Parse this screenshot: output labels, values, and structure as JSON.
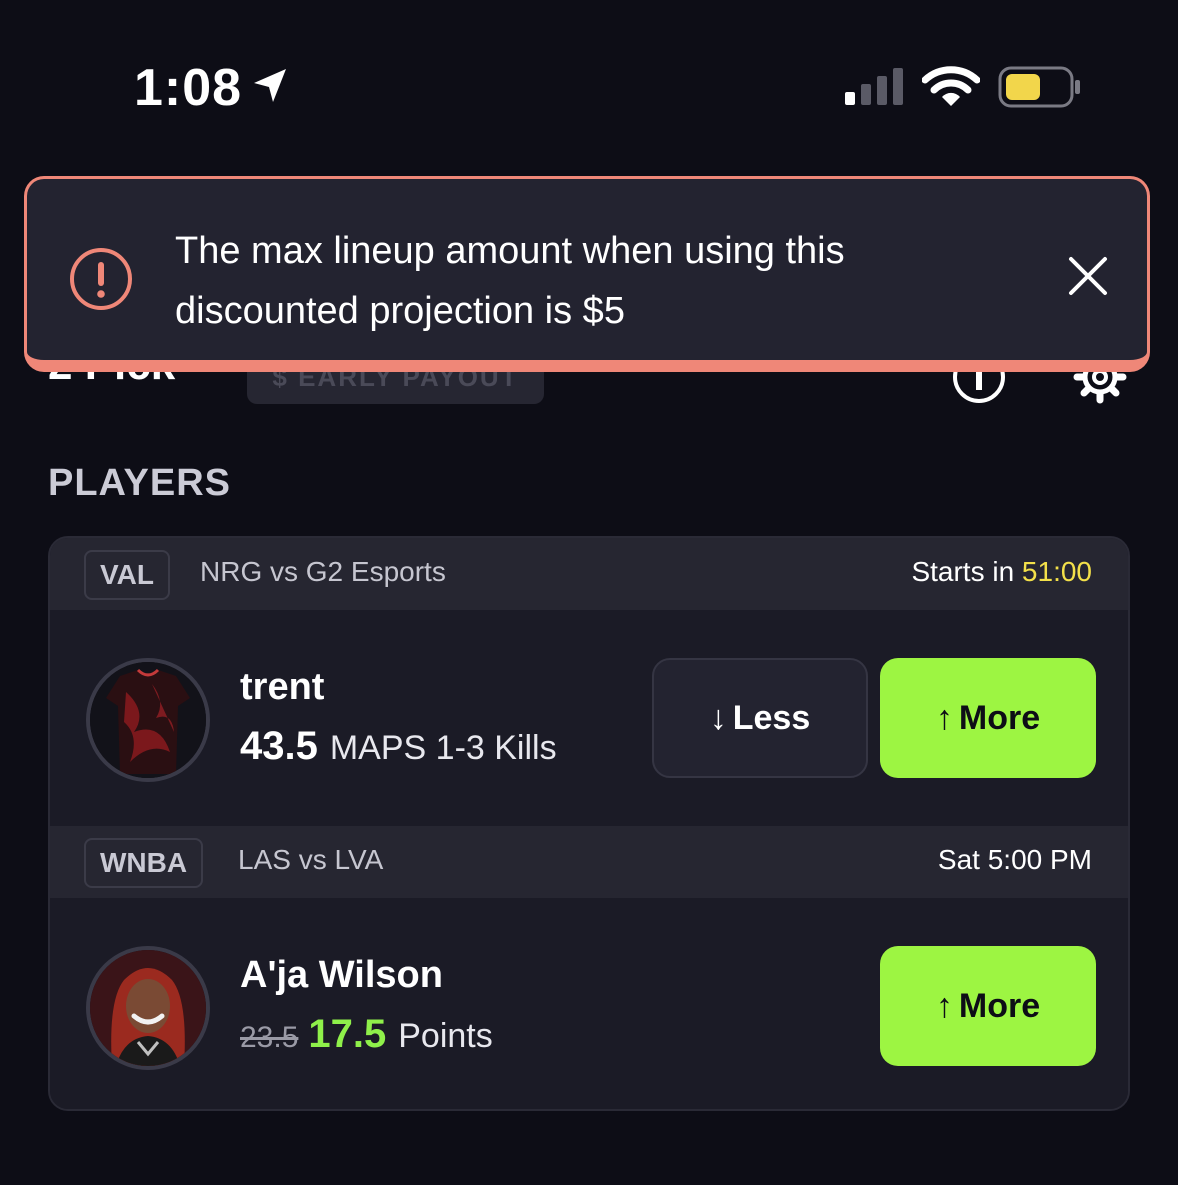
{
  "status_bar": {
    "time": "1:08",
    "icons": [
      "location-arrow-icon",
      "cellular-signal-icon",
      "wifi-icon",
      "battery-icon"
    ],
    "battery_color": "#f2d64b"
  },
  "header": {
    "title": "2 Pick",
    "payout_chip": "$ EARLY PAYOUT"
  },
  "toast": {
    "message": "The max lineup amount when using this discounted projection is $5",
    "border_color": "#ef8778"
  },
  "section": {
    "title": "PLAYERS"
  },
  "games": [
    {
      "league": "VAL",
      "matchup": "NRG vs G2 Esports",
      "start_label": "Starts in ",
      "countdown": "51:00",
      "player": {
        "name": "trent",
        "line_value": "43.5",
        "stat": "MAPS 1-3 Kills",
        "less_label": "Less",
        "more_label": "More",
        "less_arrow": "↓",
        "more_arrow": "↑"
      }
    },
    {
      "league": "WNBA",
      "matchup": "LAS vs LVA",
      "start_time": "Sat 5:00 PM",
      "player": {
        "name": "A'ja Wilson",
        "old_line": "23.5",
        "new_line": "17.5",
        "stat": "Points",
        "more_label": "More",
        "more_arrow": "↑"
      }
    }
  ],
  "colors": {
    "background": "#0d0d16",
    "accent_green": "#9df542",
    "discount_green": "#8ff04a",
    "countdown_yellow": "#f3e04a"
  }
}
